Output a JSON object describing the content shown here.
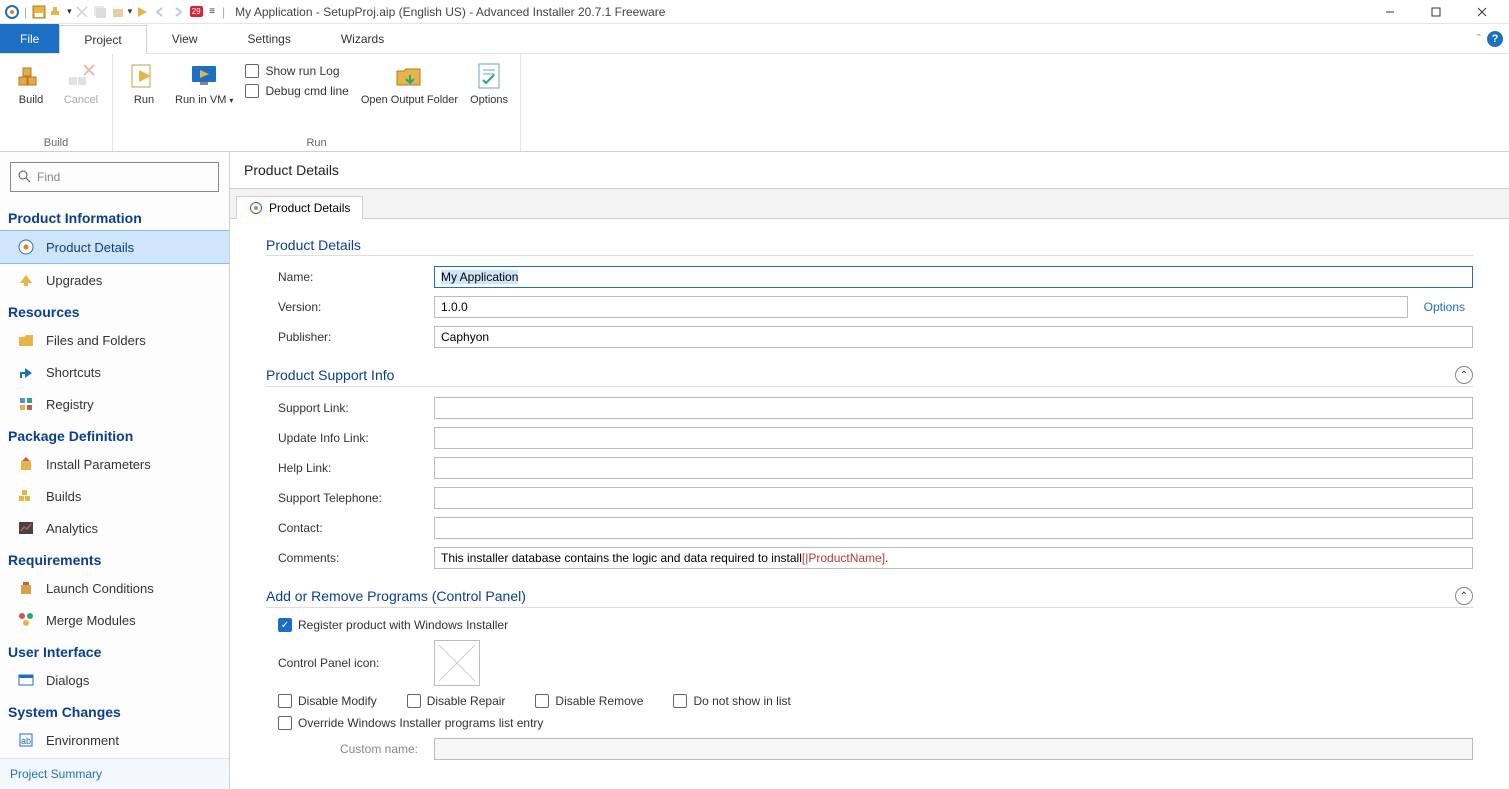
{
  "titlebar": {
    "title": "My Application - SetupProj.aip (English US) - Advanced Installer 20.7.1 Freeware",
    "qat_badge": "29"
  },
  "menu": {
    "file": "File",
    "tabs": [
      "Project",
      "View",
      "Settings",
      "Wizards"
    ]
  },
  "ribbon": {
    "build": {
      "build": "Build",
      "cancel": "Cancel",
      "group": "Build"
    },
    "run": {
      "run": "Run",
      "runvm": "Run in VM",
      "showlog": "Show run Log",
      "debugcmd": "Debug cmd line",
      "openoutput": "Open Output Folder",
      "options": "Options",
      "group": "Run"
    }
  },
  "search": {
    "placeholder": "Find"
  },
  "sidebar": {
    "sections": {
      "product_info": "Product Information",
      "resources": "Resources",
      "package_def": "Package Definition",
      "requirements": "Requirements",
      "ui": "User Interface",
      "system_changes": "System Changes"
    },
    "items": {
      "product_details": "Product Details",
      "upgrades": "Upgrades",
      "files_folders": "Files and Folders",
      "shortcuts": "Shortcuts",
      "registry": "Registry",
      "install_params": "Install Parameters",
      "builds": "Builds",
      "analytics": "Analytics",
      "launch_conditions": "Launch Conditions",
      "merge_modules": "Merge Modules",
      "dialogs": "Dialogs",
      "environment": "Environment"
    },
    "bottom": "Project Summary"
  },
  "content": {
    "title": "Product Details",
    "tab": "Product Details",
    "sections": {
      "product_details": {
        "heading": "Product Details",
        "name_label": "Name:",
        "name_value": "My Application",
        "version_label": "Version:",
        "version_value": "1.0.0",
        "version_options": "Options",
        "publisher_label": "Publisher:",
        "publisher_value": "Caphyon"
      },
      "support": {
        "heading": "Product Support Info",
        "support_link_label": "Support Link:",
        "support_link_value": "",
        "update_link_label": "Update Info Link:",
        "update_link_value": "",
        "help_link_label": "Help Link:",
        "help_link_value": "",
        "support_tel_label": "Support Telephone:",
        "support_tel_value": "",
        "contact_label": "Contact:",
        "contact_value": "",
        "comments_label": "Comments:",
        "comments_prefix": "This installer database contains the logic and data required to install ",
        "comments_token": "[|ProductName]",
        "comments_suffix": "."
      },
      "arp": {
        "heading": "Add or Remove Programs (Control Panel)",
        "register_chk": "Register product with Windows Installer",
        "cp_icon_label": "Control Panel icon:",
        "disable_modify": "Disable Modify",
        "disable_repair": "Disable Repair",
        "disable_remove": "Disable Remove",
        "no_show": "Do not show in list",
        "override_list": "Override Windows Installer programs list entry",
        "custom_name_label": "Custom name:",
        "custom_name_value": ""
      }
    }
  }
}
